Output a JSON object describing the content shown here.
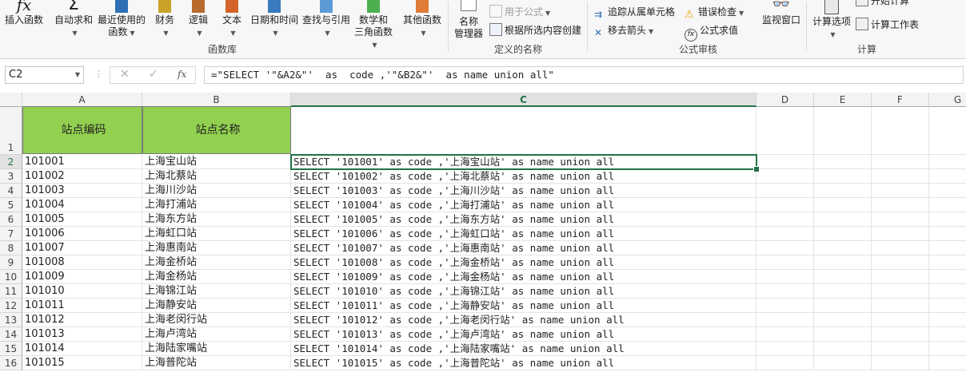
{
  "ribbon": {
    "buttons": {
      "insert_function": "插入函数",
      "autosum": "自动求和",
      "recent": "最近使用的",
      "recent2": "函数",
      "financial": "财务",
      "logical": "逻辑",
      "text": "文本",
      "datetime": "日期和时间",
      "lookup": "查找与引用",
      "math": "数学和",
      "math2": "三角函数",
      "more": "其他函数",
      "name_mgr": "名称",
      "name_mgr2": "管理器",
      "define_name": "用于公式",
      "create_from_sel": "根据所选内容创建",
      "trace_dependents": "追踪从属单元格",
      "error_check": "错误检查",
      "remove_arrows": "移去箭头",
      "evaluate": "公式求值",
      "watch_window": "监视窗口",
      "calc_options": "计算选项",
      "calc_now": "开始计算",
      "calc_sheet": "计算工作表"
    },
    "groups": {
      "function_library": "函数库",
      "defined_names": "定义的名称",
      "formula_auditing": "公式审核",
      "calculation": "计算"
    }
  },
  "formula_bar": {
    "name_box": "C2",
    "fx": "fx",
    "formula": "=\"SELECT '\"&A2&\"'  as  code ,'\"&B2&\"'  as name union all\""
  },
  "columns": [
    "A",
    "B",
    "C",
    "D",
    "E",
    "F",
    "G"
  ],
  "selected_column": "C",
  "selected_row": "2",
  "header_row": {
    "row": "1",
    "a": "站点编码",
    "b": "站点名称"
  },
  "rows": [
    {
      "row": "2",
      "a": "101001",
      "b": "上海宝山站",
      "c": "SELECT '101001'  as  code ,'上海宝山站'  as name union all"
    },
    {
      "row": "3",
      "a": "101002",
      "b": "上海北蔡站",
      "c": "SELECT '101002'  as  code ,'上海北蔡站'  as name union all"
    },
    {
      "row": "4",
      "a": "101003",
      "b": "上海川沙站",
      "c": "SELECT '101003'  as  code ,'上海川沙站'  as name union all"
    },
    {
      "row": "5",
      "a": "101004",
      "b": "上海打浦站",
      "c": "SELECT '101004'  as  code ,'上海打浦站'  as name union all"
    },
    {
      "row": "6",
      "a": "101005",
      "b": "上海东方站",
      "c": "SELECT '101005'  as  code ,'上海东方站'  as name union all"
    },
    {
      "row": "7",
      "a": "101006",
      "b": "上海虹口站",
      "c": "SELECT '101006'  as  code ,'上海虹口站'  as name union all"
    },
    {
      "row": "8",
      "a": "101007",
      "b": "上海惠南站",
      "c": "SELECT '101007'  as  code ,'上海惠南站'  as name union all"
    },
    {
      "row": "9",
      "a": "101008",
      "b": "上海金桥站",
      "c": "SELECT '101008'  as  code ,'上海金桥站'  as name union all"
    },
    {
      "row": "10",
      "a": "101009",
      "b": "上海金杨站",
      "c": "SELECT '101009'  as  code ,'上海金杨站'  as name union all"
    },
    {
      "row": "11",
      "a": "101010",
      "b": "上海锦江站",
      "c": "SELECT '101010'  as  code ,'上海锦江站'  as name union all"
    },
    {
      "row": "12",
      "a": "101011",
      "b": "上海静安站",
      "c": "SELECT '101011'  as  code ,'上海静安站'  as name union all"
    },
    {
      "row": "13",
      "a": "101012",
      "b": "上海老闵行站",
      "c": "SELECT '101012'  as  code ,'上海老闵行站'  as name union all"
    },
    {
      "row": "14",
      "a": "101013",
      "b": "上海卢湾站",
      "c": "SELECT '101013'  as  code ,'上海卢湾站'  as name union all"
    },
    {
      "row": "15",
      "a": "101014",
      "b": "上海陆家嘴站",
      "c": "SELECT '101014'  as  code ,'上海陆家嘴站'  as name union all"
    },
    {
      "row": "16",
      "a": "101015",
      "b": "上海普陀站",
      "c": "SELECT '101015'  as  code ,'上海普陀站'  as name union all"
    }
  ],
  "colors": {
    "accent": "#217346",
    "header_fill": "#92d050"
  }
}
